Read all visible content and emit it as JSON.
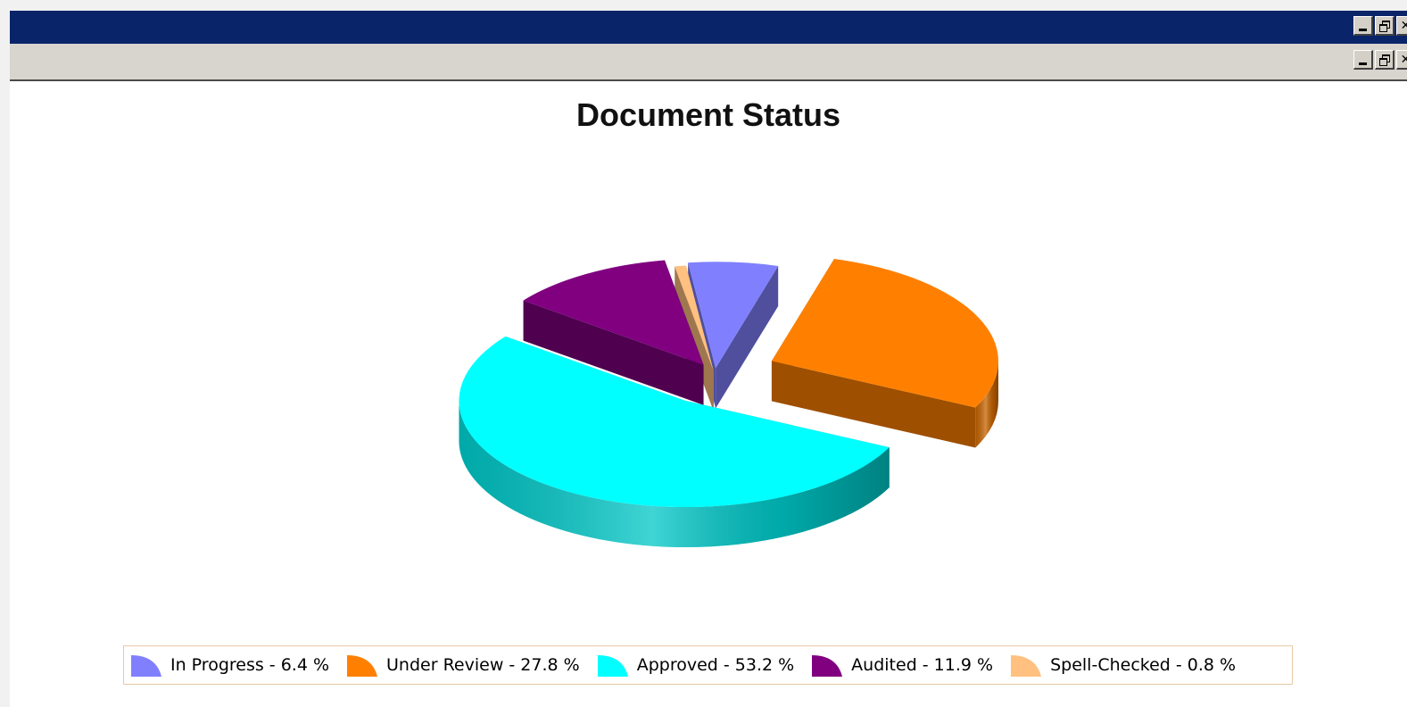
{
  "window": {
    "controls": [
      "minimize-icon",
      "restore-icon",
      "close-icon"
    ],
    "title_bar_color": "#0a246a",
    "menu_bar_color": "#d8d4ce"
  },
  "chart_data": {
    "type": "pie",
    "style": "3d-exploded",
    "title": "Document Status",
    "legend_position": "bottom",
    "slices": [
      {
        "label": "In Progress - 6.4 %",
        "category": "In Progress",
        "value": 6.4,
        "color": "#8080ff"
      },
      {
        "label": "Under Review - 27.8 %",
        "category": "Under Review",
        "value": 27.8,
        "color": "#ff8000"
      },
      {
        "label": "Approved - 53.2 %",
        "category": "Approved",
        "value": 53.2,
        "color": "#00ffff"
      },
      {
        "label": "Audited - 11.9 %",
        "category": "Audited",
        "value": 11.9,
        "color": "#800080"
      },
      {
        "label": "Spell-Checked - 0.8 %",
        "category": "Spell-Checked",
        "value": 0.8,
        "color": "#ffc080"
      }
    ]
  }
}
